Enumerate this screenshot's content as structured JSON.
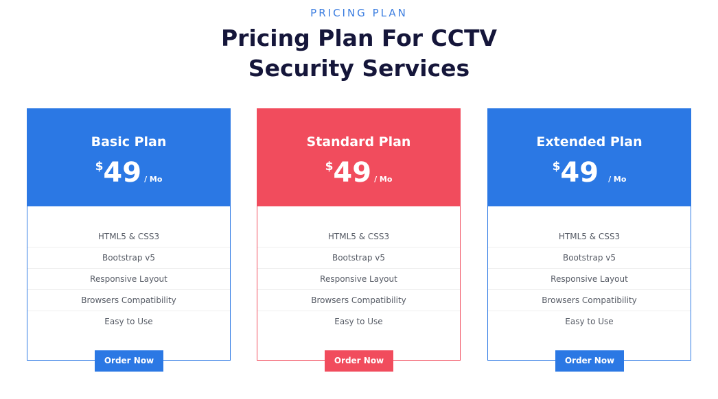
{
  "header": {
    "tag": "PRICING PLAN",
    "title_line1": "Pricing Plan For CCTV",
    "title_line2": "Security Services"
  },
  "colors": {
    "blue": "#2b78e4",
    "red": "#f14c5d",
    "title": "#15163a"
  },
  "plans": [
    {
      "name": "Basic Plan",
      "currency": "$",
      "price": "49",
      "period": "/ Mo",
      "features": [
        "HTML5 & CSS3",
        "Bootstrap v5",
        "Responsive Layout",
        "Browsers Compatibility",
        "Easy to Use"
      ],
      "button": "Order Now",
      "accent": "#2b78e4"
    },
    {
      "name": "Standard Plan",
      "currency": "$",
      "price": "49",
      "period": "/ Mo",
      "features": [
        "HTML5 & CSS3",
        "Bootstrap v5",
        "Responsive Layout",
        "Browsers Compatibility",
        "Easy to Use"
      ],
      "button": "Order Now",
      "accent": "#f14c5d"
    },
    {
      "name": "Extended Plan",
      "currency": "$",
      "price": "49",
      "period": "/ Mo",
      "features": [
        "HTML5 & CSS3",
        "Bootstrap v5",
        "Responsive Layout",
        "Browsers Compatibility",
        "Easy to Use"
      ],
      "button": "Order Now",
      "accent": "#2b78e4"
    }
  ]
}
